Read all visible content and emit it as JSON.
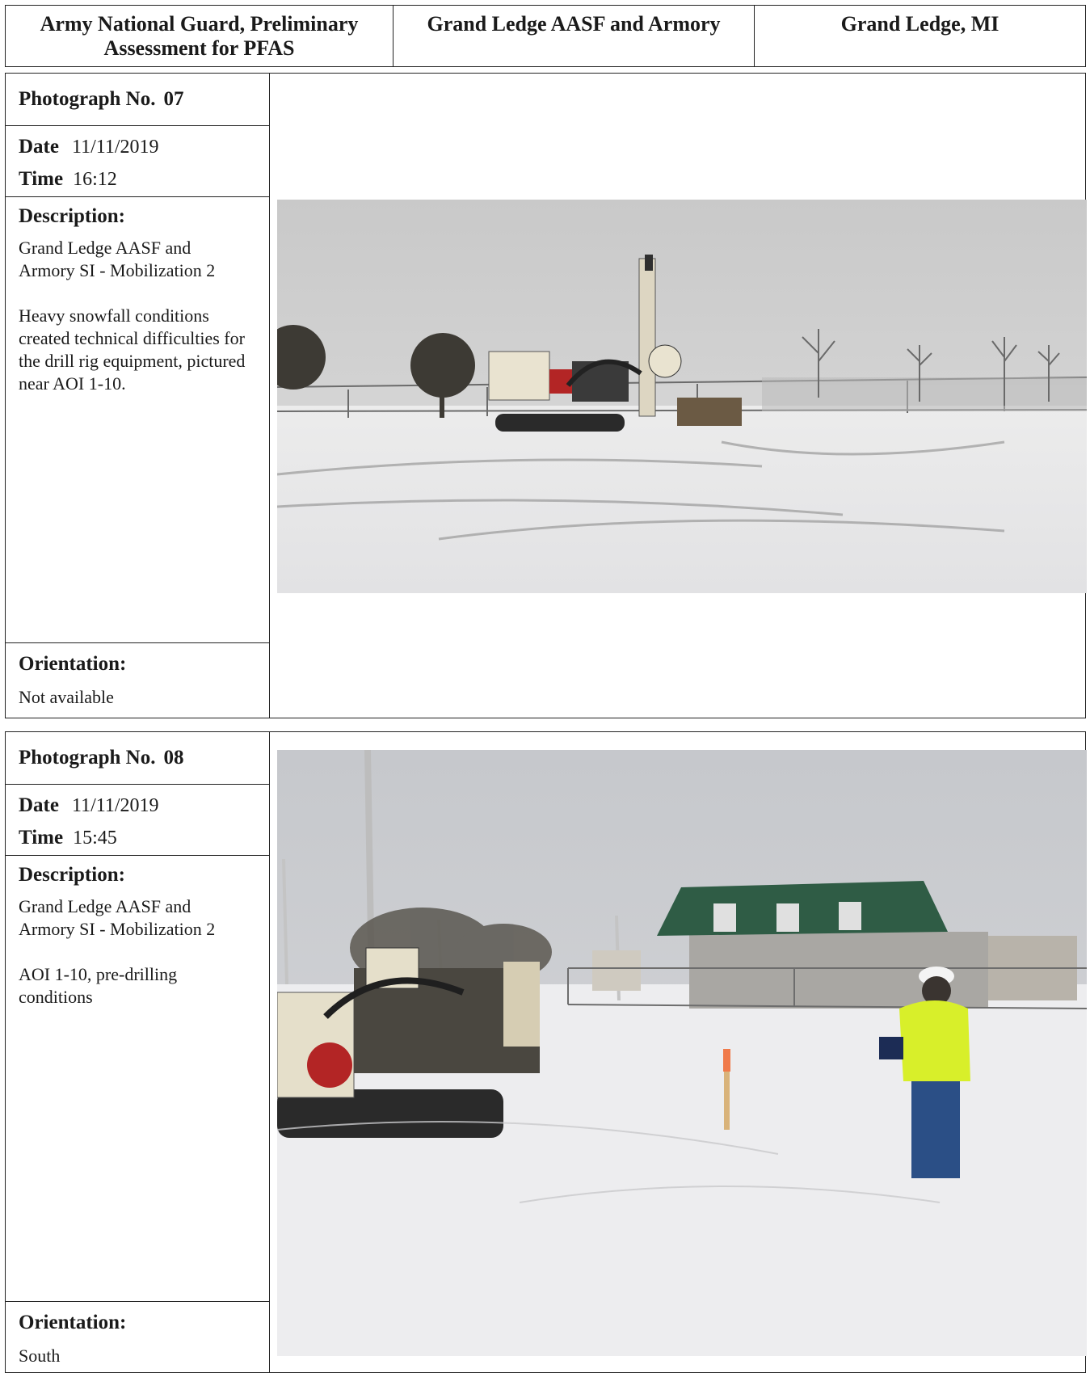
{
  "header": {
    "org": "Army National Guard, Preliminary Assessment for PFAS",
    "site": "Grand Ledge AASF and Armory",
    "location": "Grand Ledge, MI"
  },
  "labels": {
    "photo_no": "Photograph No.",
    "date": "Date",
    "time": "Time",
    "description": "Description:",
    "orientation": "Orientation:"
  },
  "photos": [
    {
      "number": "07",
      "date": "11/11/2019",
      "time": "16:12",
      "description_1": "Grand Ledge AASF and Armory SI - Mobilization 2",
      "description_2": "Heavy snowfall conditions created technical difficulties for the drill rig equipment, pictured near AOI 1-10.",
      "orientation": "Not available",
      "image_subject": "drill rig on tracks in snow-covered field with chain-link fence and bare trees"
    },
    {
      "number": "08",
      "date": "11/11/2019",
      "time": "15:45",
      "description_1": "Grand Ledge AASF and Armory SI - Mobilization 2",
      "description_2": "AOI 1-10, pre-drilling conditions",
      "orientation": "South",
      "image_subject": "worker in hi-vis jacket beside drill rig, marker stake in snow, building with green roof"
    }
  ]
}
